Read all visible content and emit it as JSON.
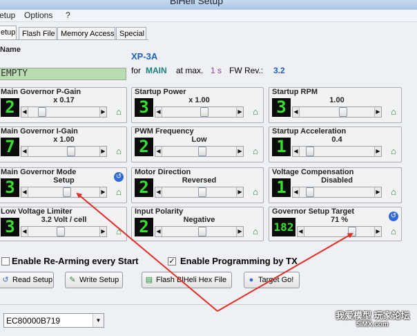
{
  "window": {
    "title": "BlHeli Setup"
  },
  "menu": [
    "etup",
    "Options",
    "?"
  ],
  "tabs": [
    {
      "label": "etup",
      "active": true
    },
    {
      "label": "Flash File",
      "active": false
    },
    {
      "label": "Memory Access",
      "active": false
    },
    {
      "label": "Special",
      "active": false
    }
  ],
  "name_panel": {
    "label": "Name",
    "value": "EMPTY"
  },
  "info": {
    "model": "XP-3A",
    "for_label": "for",
    "mode": "MAIN",
    "at_label": "at max.",
    "time": "1 s",
    "fw_label": "FW Rev.:",
    "fw_rev": "3.2"
  },
  "params": [
    {
      "title": "Main Governor P-Gain",
      "display": "2",
      "value": "x 0.17",
      "fraction": 0.15,
      "blue_icon": false
    },
    {
      "title": "Startup Power",
      "display": "3",
      "value": "x 1.00",
      "fraction": 0.58,
      "blue_icon": false
    },
    {
      "title": "Startup RPM",
      "display": "3",
      "value": "1.00",
      "fraction": 0.6,
      "blue_icon": false
    },
    {
      "title": "Main Governor I-Gain",
      "display": "7",
      "value": "x 1.00",
      "fraction": 0.62,
      "blue_icon": false
    },
    {
      "title": "PWM Frequency",
      "display": "2",
      "value": "Low",
      "fraction": 0.55,
      "blue_icon": false
    },
    {
      "title": "Startup Acceleration",
      "display": "1",
      "value": "0.4",
      "fraction": 0.08,
      "blue_icon": false
    },
    {
      "title": "Main Governor Mode",
      "display": "3",
      "value": "Setup",
      "fraction": 0.55,
      "blue_icon": true
    },
    {
      "title": "Motor Direction",
      "display": "2",
      "value": "Reversed",
      "fraction": 0.55,
      "blue_icon": false
    },
    {
      "title": "Voltage Compensation",
      "display": "1",
      "value": "Disabled",
      "fraction": 0.08,
      "blue_icon": false
    },
    {
      "title": "Low Voltage Limiter",
      "display": "3",
      "value": "3.2 Volt / cell",
      "fraction": 0.45,
      "blue_icon": false
    },
    {
      "title": "Input Polarity",
      "display": "2",
      "value": "Negative",
      "fraction": 0.55,
      "blue_icon": false
    },
    {
      "title": "Governor Setup Target",
      "display": "182",
      "value": "71 %",
      "fraction": 0.71,
      "blue_icon": true
    }
  ],
  "checkboxes": [
    {
      "label": "Enable Re-Arming every Start",
      "checked": false,
      "mark": ""
    },
    {
      "label": "Enable Programming by TX",
      "checked": true,
      "mark": "✓"
    }
  ],
  "buttons": [
    {
      "label": "Read Setup",
      "icon": "↺"
    },
    {
      "label": "Write Setup",
      "icon": "✎"
    },
    {
      "label": "Flash BlHeli Hex File",
      "icon": "▤"
    },
    {
      "label": "Target Go!",
      "icon": "●"
    }
  ],
  "combo": {
    "value": "EC80000B719"
  },
  "watermark": {
    "line1": "我爱模型 玩家论坛",
    "line2": "5iMX.com"
  },
  "colors": {
    "display_bg": "#0c0c0c",
    "display_fg": "#37e02f",
    "info_blue": "#1b5fbf",
    "main_teal": "#19807d",
    "time_purple": "#8b3fa3",
    "arrow_red": "#e42b24",
    "name_green": "#b9dcb0"
  }
}
